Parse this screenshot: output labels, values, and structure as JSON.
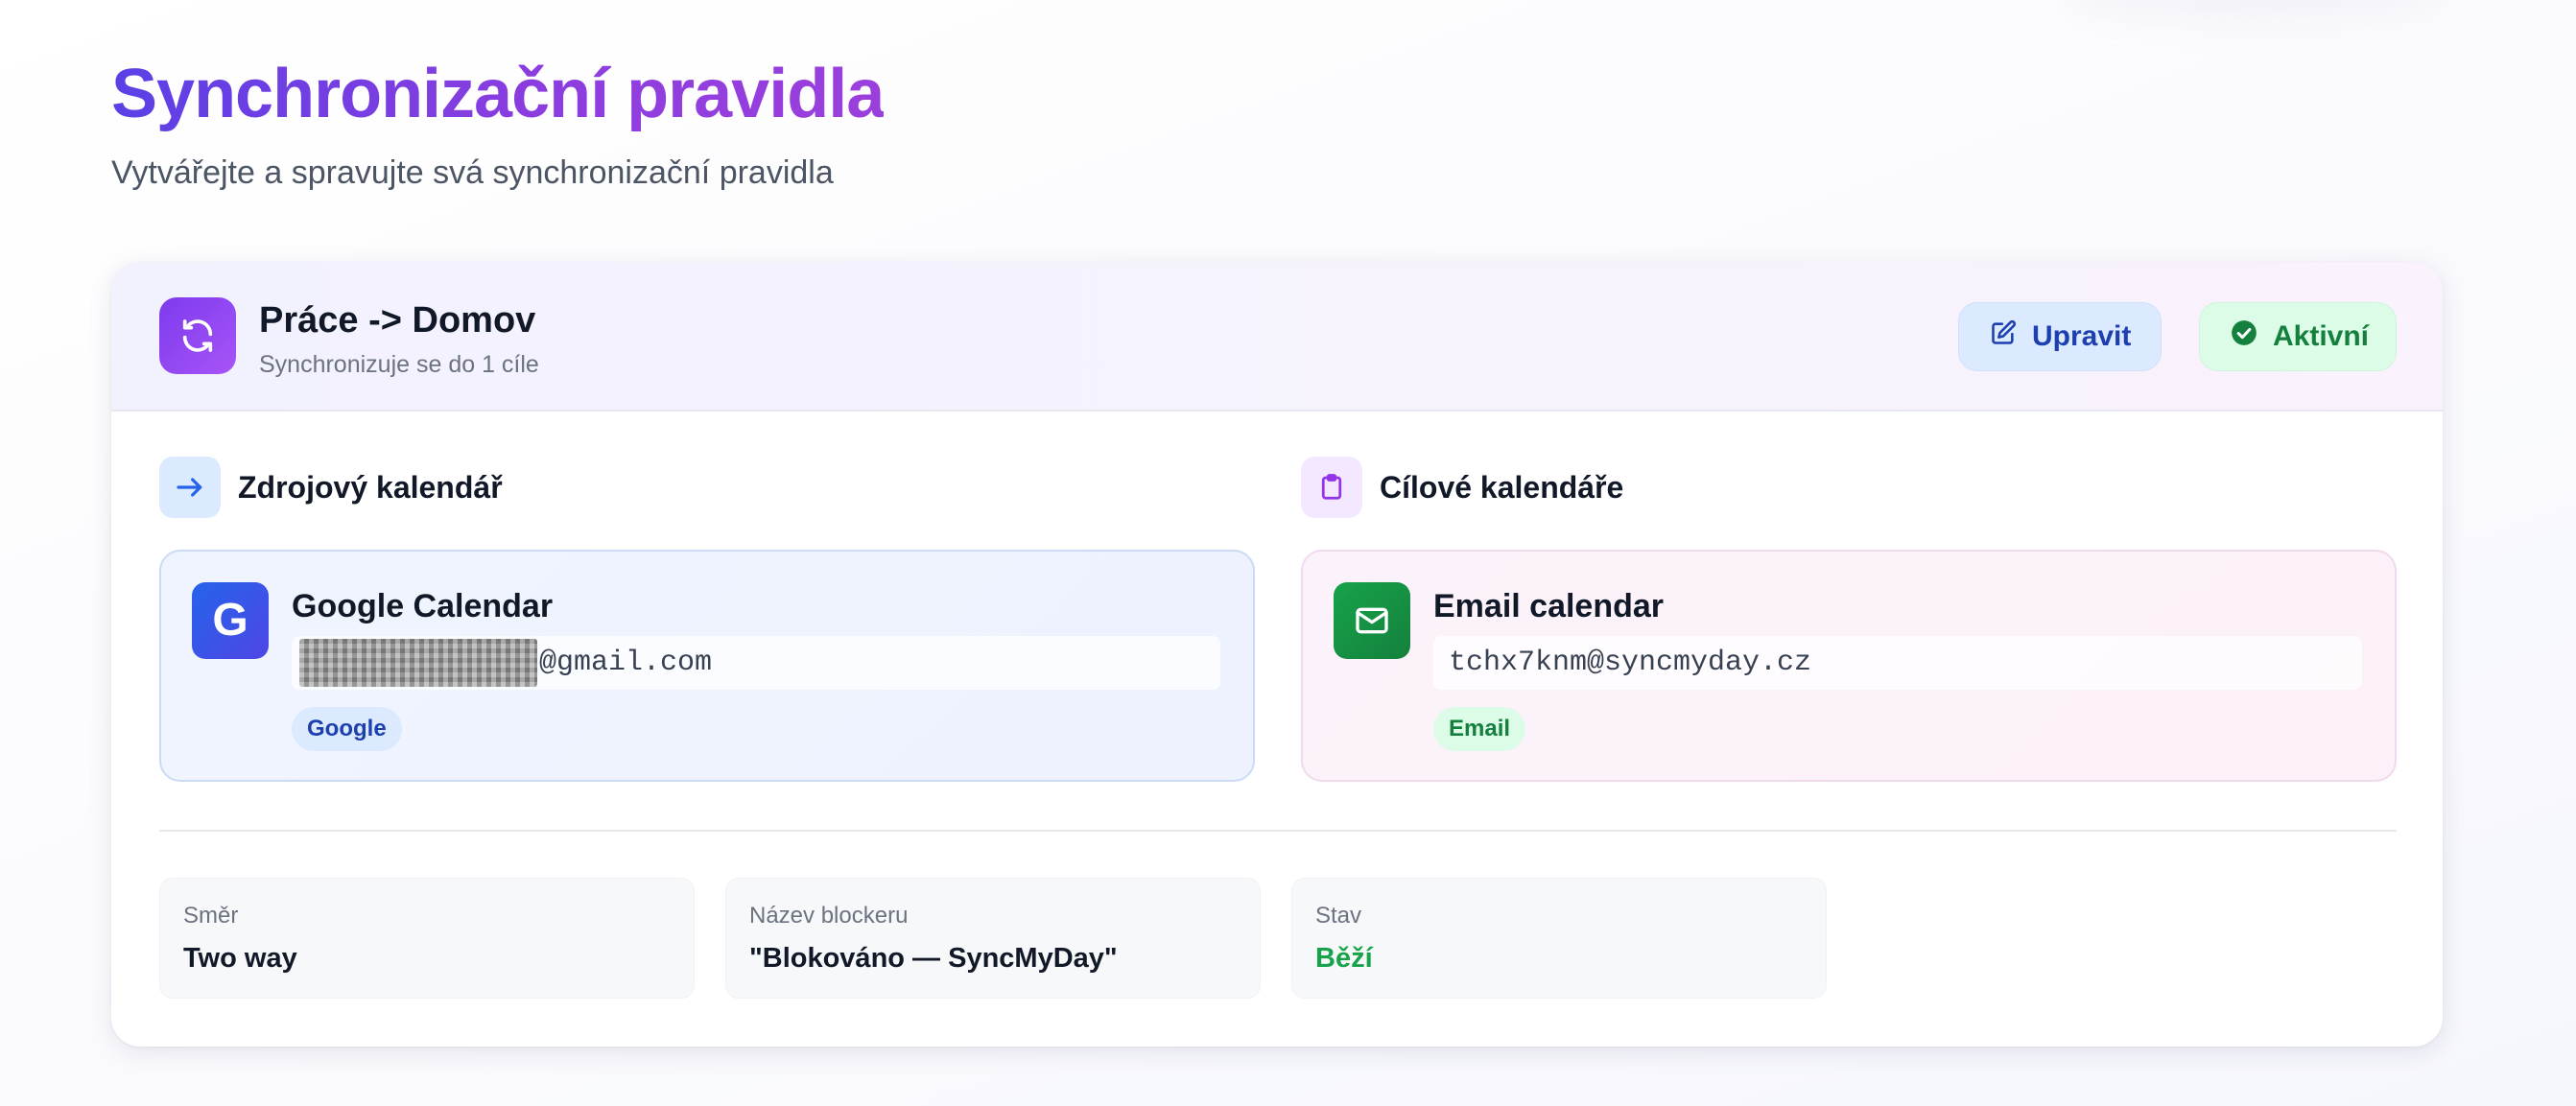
{
  "page": {
    "title": "Synchronizační pravidla",
    "subtitle": "Vytvářejte a spravujte svá synchronizační pravidla"
  },
  "rule": {
    "icon": "sync-icon",
    "title": "Práce -> Domov",
    "subtitle": "Synchronizuje se do 1 cíle",
    "edit_label": "Upravit",
    "status_label": "Aktivní"
  },
  "source": {
    "section_label": "Zdrojový kalendář",
    "section_icon": "arrow-right-icon",
    "calendar": {
      "logo_letter": "G",
      "name": "Google Calendar",
      "email_suffix": "@gmail.com",
      "email_redacted": true,
      "badge": "Google"
    }
  },
  "target": {
    "section_label": "Cílové kalendáře",
    "section_icon": "clipboard-icon",
    "calendar": {
      "name": "Email calendar",
      "email": "tchx7knm@syncmyday.cz",
      "badge": "Email"
    }
  },
  "details": [
    {
      "label": "Směr",
      "value": "Two way"
    },
    {
      "label": "Název blockeru",
      "value": "\"Blokováno — SyncMyDay\""
    },
    {
      "label": "Stav",
      "value": "Běží"
    }
  ],
  "colors": {
    "title_gradient_start": "#5b40e6",
    "title_gradient_end": "#9b3fdc",
    "accent_purple": "#7c3aed",
    "edit_button_bg": "#dbeafe",
    "edit_button_text": "#1e40af",
    "active_badge_bg": "#dcfce7",
    "active_badge_text": "#15803d",
    "status_running": "#16a34a"
  }
}
